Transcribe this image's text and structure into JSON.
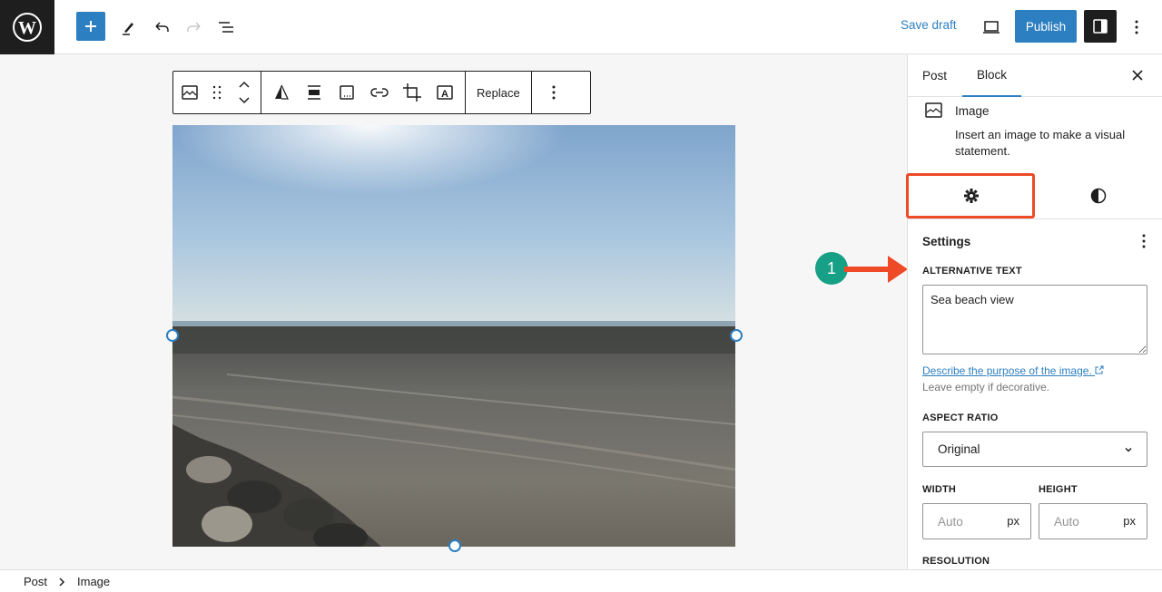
{
  "topbar": {
    "logo": "wordpress-logo",
    "save_draft": "Save draft",
    "publish": "Publish",
    "icons": [
      "plus-icon",
      "pencil-icon",
      "undo-icon",
      "redo-icon",
      "list-view-icon",
      "desktop-preview-icon",
      "sidebar-toggle-icon",
      "more-vertical-icon"
    ]
  },
  "block_toolbar": {
    "replace": "Replace",
    "icons": [
      "image-icon",
      "drag-handle-icon",
      "move-up-down-icon",
      "duotone-icon",
      "align-icon",
      "caption-icon",
      "link-icon",
      "crop-icon",
      "text-overlay-icon",
      "more-vertical-icon"
    ]
  },
  "image": {
    "alt": "Sea beach view"
  },
  "sidebar": {
    "tabs": [
      {
        "label": "Post",
        "active": false
      },
      {
        "label": "Block",
        "active": true
      }
    ],
    "block_card": {
      "title": "Image",
      "description": "Insert an image to make a visual statement."
    },
    "subtabs": [
      "settings-gear-icon",
      "styles-contrast-icon"
    ],
    "settings": {
      "title": "Settings",
      "alt_label": "ALTERNATIVE TEXT",
      "alt_value": "Sea beach view",
      "help_link": "Describe the purpose of the image.",
      "help_text": "Leave empty if decorative.",
      "aspect_label": "ASPECT RATIO",
      "aspect_value": "Original",
      "width_label": "WIDTH",
      "height_label": "HEIGHT",
      "width_placeholder": "Auto",
      "height_placeholder": "Auto",
      "unit": "px",
      "resolution_label": "RESOLUTION"
    }
  },
  "annotation": {
    "number": "1",
    "highlight_color": "#ee4a27",
    "badge_color": "#16a085"
  },
  "breadcrumb": [
    "Post",
    "Image"
  ],
  "colors": {
    "accent": "#2c7fc0",
    "dark": "#1e1e1e"
  }
}
